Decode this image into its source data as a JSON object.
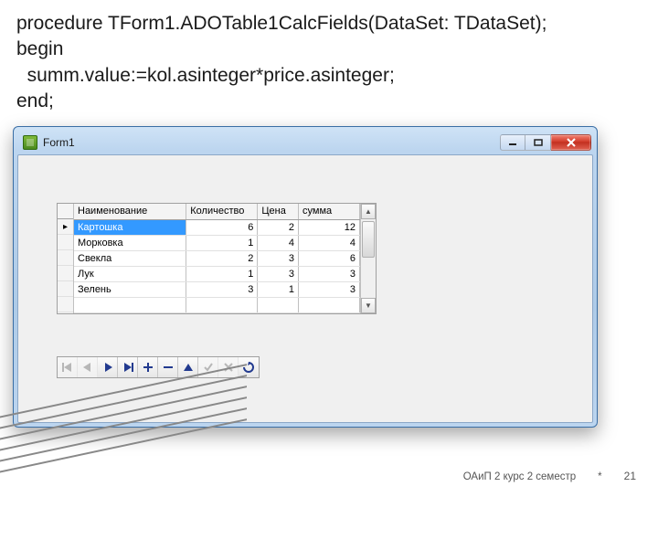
{
  "code": {
    "line1": "procedure TForm1.ADOTable1CalcFields(DataSet: TDataSet);",
    "line2": "begin",
    "line3": "  summ.value:=kol.asinteger*price.asinteger;",
    "line4": "end;"
  },
  "window": {
    "title": "Form1"
  },
  "grid": {
    "headers": [
      "Наименование",
      "Количество",
      "Цена",
      "сумма"
    ],
    "rows": [
      {
        "name": "Картошка",
        "qty": "6",
        "price": "2",
        "sum": "12",
        "selected": true
      },
      {
        "name": "Морковка",
        "qty": "1",
        "price": "4",
        "sum": "4"
      },
      {
        "name": "Свекла",
        "qty": "2",
        "price": "3",
        "sum": "6"
      },
      {
        "name": "Лук",
        "qty": "1",
        "price": "3",
        "sum": "3"
      },
      {
        "name": "Зелень",
        "qty": "3",
        "price": "1",
        "sum": "3"
      }
    ]
  },
  "footer": {
    "course": "ОАиП 2 курс 2 семестр",
    "star": "*",
    "page": "21"
  },
  "icons": {
    "first": "|◂",
    "prior": "◂",
    "next": "▸",
    "last": "▸|",
    "insert": "＋",
    "delete": "－",
    "edit": "▲",
    "post": "✓",
    "cancel": "✕",
    "refresh": "↻"
  }
}
